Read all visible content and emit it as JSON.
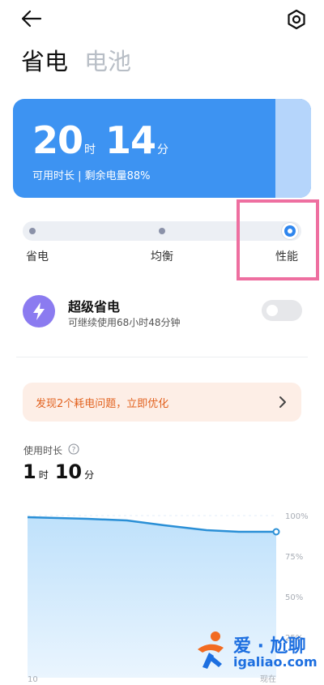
{
  "header": {
    "back_icon": "arrow-left-icon",
    "settings_icon": "gear-icon"
  },
  "tabs": [
    {
      "label": "省电",
      "active": true
    },
    {
      "label": "电池",
      "active": false
    }
  ],
  "battery_card": {
    "hours": "20",
    "hours_unit": "时",
    "minutes": "14",
    "minutes_unit": "分",
    "subtitle": "可用时长 | 剩余电量88%",
    "battery_level": 0.88,
    "color": "#3d93f2"
  },
  "power_modes": {
    "options": [
      "省电",
      "均衡",
      "性能"
    ],
    "selected": "性能"
  },
  "super_saver": {
    "icon": "lightning-icon",
    "title": "超级省电",
    "description": "可继续使用68小时48分钟",
    "enabled": false
  },
  "alert": {
    "text": "发现2个耗电问题，立即优化",
    "color": "#e2621f"
  },
  "usage": {
    "label": "使用时长",
    "help_icon": "question-circle-icon",
    "hours": "1",
    "hours_unit": "时",
    "minutes": "10",
    "minutes_unit": "分"
  },
  "chart_data": {
    "type": "area",
    "x_labels": [
      "10",
      "现在"
    ],
    "y_ticks": [
      "100%",
      "75%",
      "50%",
      "25%"
    ],
    "x": [
      0,
      0.24,
      0.4,
      0.55,
      0.72,
      0.85,
      1
    ],
    "values": [
      99,
      98,
      97,
      94,
      91,
      90,
      90
    ],
    "ylim": [
      0,
      100
    ],
    "color": "#2a8fd6"
  },
  "watermark": {
    "title": "爱 · 尬聊",
    "url": "igaliao.com"
  }
}
